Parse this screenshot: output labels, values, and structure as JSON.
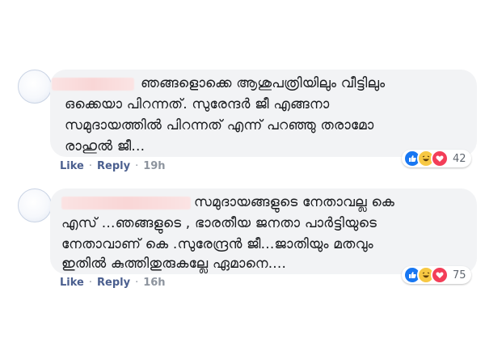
{
  "comments": [
    {
      "lines": [
        "ഞങ്ങളൊക്കെ ആശുപത്രിയിലും വീട്ടിലും",
        "ഒക്കെയാ പിറന്നത്. സുരേന്ദർ ജീ എങ്ങനാ",
        "സമുദായത്തിൽ പിറന്നത് എന്ന് പറഞ്ഞു തരാമോ",
        "രാഹുൽ ജീ..."
      ],
      "like_label": "Like",
      "reply_label": "Reply",
      "separator": "·",
      "time": "19h",
      "reaction_count": "42"
    },
    {
      "lines": [
        "സമുദായങ്ങളുടെ നേതാവല്ല കെ",
        "എസ് ...ഞങ്ങളുടെ , ഭാരതീയ ജനതാ പാർട്ടിയുടെ",
        "നേതാവാണ് കെ .സുരേന്ദ്രൻ ജീ...ജാതിയും മതവും",
        "ഇതിൽ കുത്തിതുരുകല്ലേ ഏമാനെ...."
      ],
      "like_label": "Like",
      "reply_label": "Reply",
      "separator": "·",
      "time": "16h",
      "reaction_count": "75"
    }
  ],
  "reaction_icons": [
    "like-icon",
    "haha-icon",
    "love-icon"
  ],
  "colors": {
    "bubble": "#f2f3f5",
    "link": "#4b5f8f",
    "like": "#1877f2",
    "haha": "#f7c843",
    "love": "#f33e58"
  }
}
